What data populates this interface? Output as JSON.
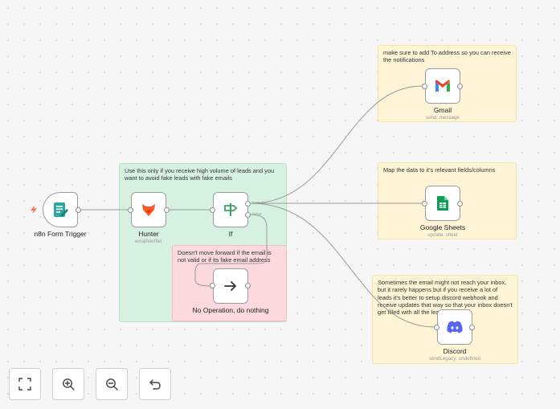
{
  "stickies": {
    "gmail_note": "make sure to add To address so you can receive the notifications",
    "sheets_note": "Map the data to it's relevant fields/columns",
    "discord_note": "Sometimes the email might not reach your inbox, but it rarely happens but if you receive a lot of leads it's better to setup discord webhook and receive updates that way so that your inbox doesn't get filled with all the leads",
    "hunter_note": "Use this only if you receive high volume of leads and you want to avoid fake leads with fake emails",
    "noop_note": "Doesn't move forward if the email is not valid or if its fake email address"
  },
  "nodes": {
    "trigger": {
      "label": "n8n Form Trigger"
    },
    "hunter": {
      "label": "Hunter",
      "sublabel": "emailVerifier"
    },
    "if": {
      "label": "If",
      "true_label": "true",
      "false_label": "false"
    },
    "noop": {
      "label": "No Operation, do nothing"
    },
    "gmail": {
      "label": "Gmail",
      "sublabel": "send: message"
    },
    "sheets": {
      "label": "Google Sheets",
      "sublabel": "update: sheet"
    },
    "discord": {
      "label": "Discord",
      "sublabel": "sendLegacy: undefined"
    }
  },
  "controls": {
    "fit": "fit-view-icon",
    "zoom_in": "zoom-in-icon",
    "zoom_out": "zoom-out-icon",
    "reset": "reset-zoom-icon"
  },
  "colors": {
    "hunter": "#ff5722",
    "sheets": "#0f9d58",
    "discord": "#5865f2",
    "trigger": "#2aa6a0",
    "sticky_yellow": "#fff5d6",
    "sticky_green": "#d7f1e1",
    "sticky_red": "#fcd9dc"
  }
}
